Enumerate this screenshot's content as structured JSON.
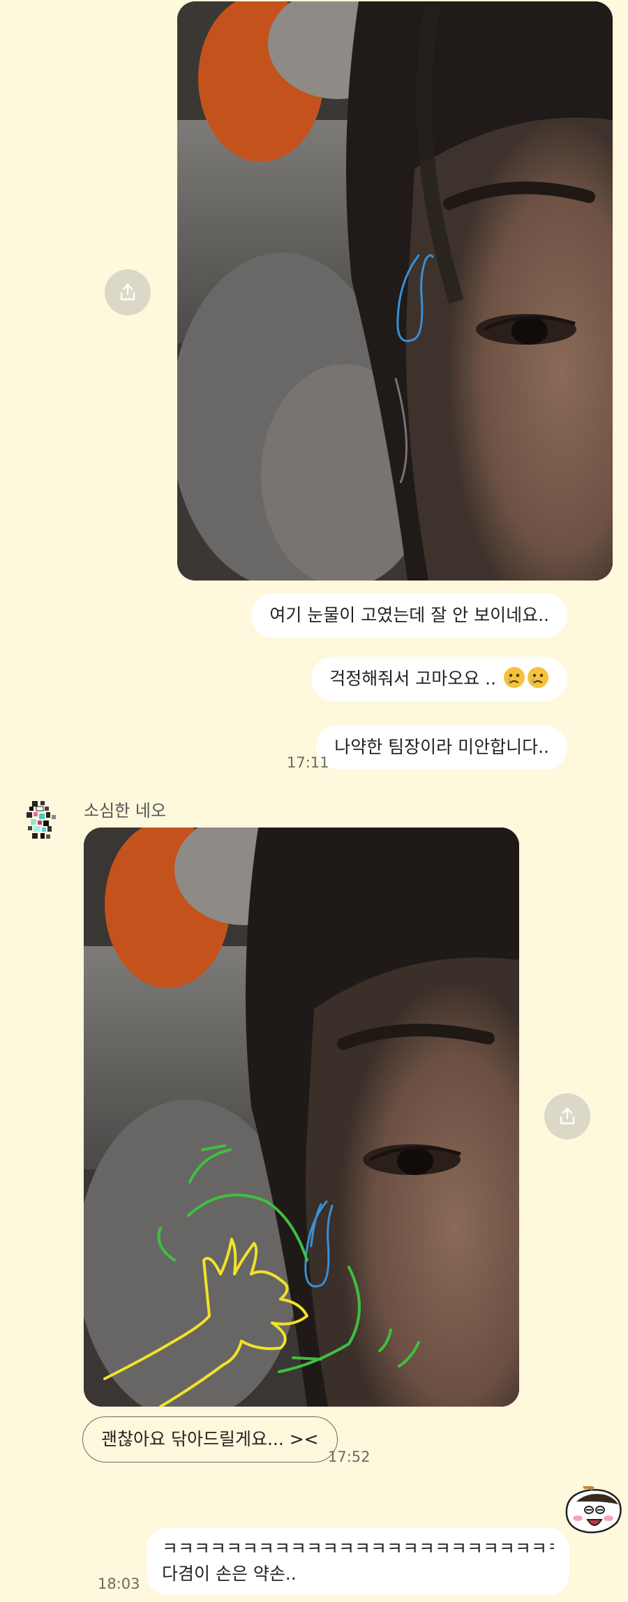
{
  "messages": {
    "photo1": {
      "description_icon": "share-icon"
    },
    "sent_bubble_1": "여기 눈물이 고였는데 잘 안 보이네요..",
    "sent_bubble_2": "걱정해줘서 고마오요 ..",
    "sent_bubble_3": "나약한 팀장이라 미안합니다..",
    "sent_time_1": "17:11",
    "sender_name": "소심한 네오",
    "recv_bubble_1": "괜찮아요 닦아드릴게요... ><",
    "recv_time_1": "17:52",
    "sent_bubble_4_line1": "ㅋㅋㅋㅋㅋㅋㅋㅋㅋㅋㅋㅋㅋㅋㅋㅋㅋㅋㅋㅋㅋㅋㅋㅋㅋ ㅜㅜ",
    "sent_bubble_4_line2": "다겸이 손은 약손..",
    "sent_time_2": "18:03"
  },
  "colors": {
    "background": "#fef8dc",
    "bubble": "#ffffff",
    "share_button": "#dcd8c8",
    "tear_stroke": "#3b8fd6",
    "hand_stroke": "#f2e22a",
    "outline_stroke": "#3fbf3f"
  }
}
